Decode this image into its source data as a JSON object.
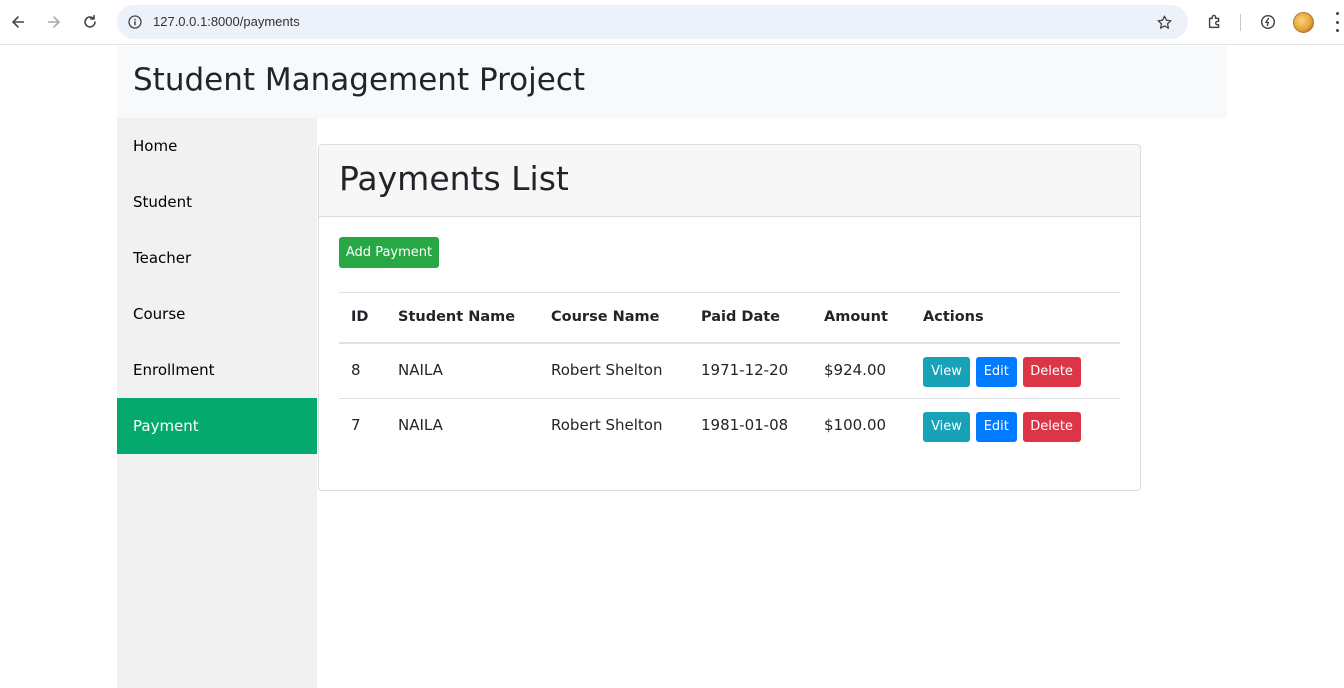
{
  "browser": {
    "url": "127.0.0.1:8000/payments"
  },
  "header": {
    "title": "Student Management Project"
  },
  "sidebar": {
    "items": [
      {
        "label": "Home"
      },
      {
        "label": "Student"
      },
      {
        "label": "Teacher"
      },
      {
        "label": "Course"
      },
      {
        "label": "Enrollment"
      },
      {
        "label": "Payment",
        "active": true
      }
    ],
    "active_color": "#04aa6d"
  },
  "main": {
    "title": "Payments List",
    "add_button": "Add Payment",
    "table": {
      "columns": [
        "ID",
        "Student Name",
        "Course Name",
        "Paid Date",
        "Amount",
        "Actions"
      ],
      "rows": [
        {
          "id": "8",
          "student": "NAILA",
          "course": "Robert Shelton",
          "paid_date": "1971-12-20",
          "amount": "$924.00"
        },
        {
          "id": "7",
          "student": "NAILA",
          "course": "Robert Shelton",
          "paid_date": "1981-01-08",
          "amount": "$100.00"
        }
      ],
      "action_labels": {
        "view": "View",
        "edit": "Edit",
        "delete": "Delete"
      }
    }
  },
  "colors": {
    "add": "#28a745",
    "view": "#17a2b8",
    "edit": "#007bff",
    "delete": "#dc3545"
  }
}
